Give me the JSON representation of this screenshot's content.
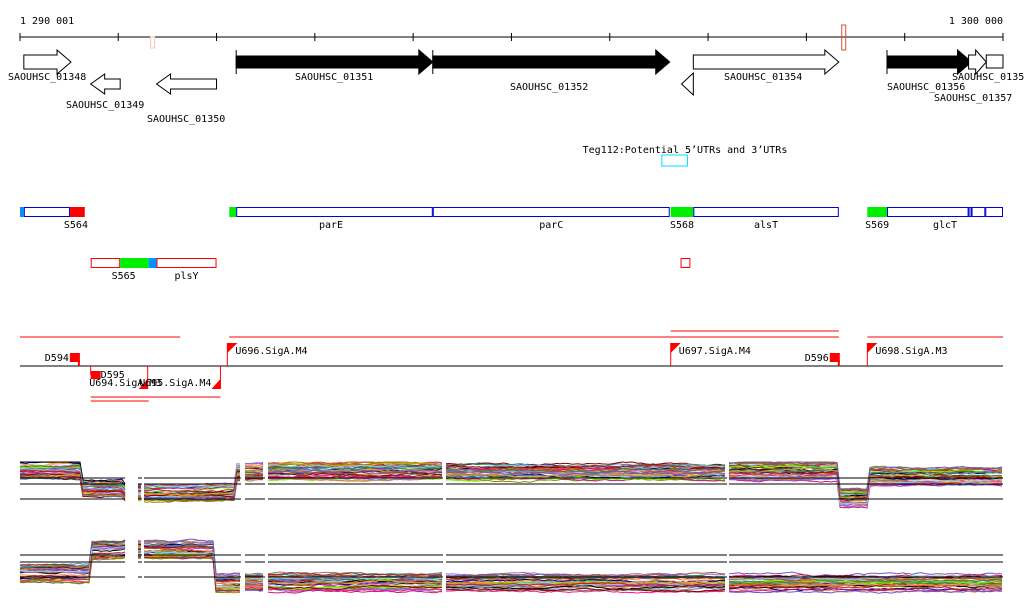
{
  "ruler": {
    "start_label": "1 290 001",
    "end_label": "1 300 000",
    "start": 1290001,
    "end": 1300000,
    "tick_interval": 1000
  },
  "markers": [
    {
      "pos": 1291350,
      "color": "#f4c8b0"
    },
    {
      "pos": 1298380,
      "color": "#e05030"
    }
  ],
  "genes": [
    {
      "label": "SAOUHSC_01348",
      "start": 1290040,
      "end": 1290520,
      "strand": "+",
      "filled": false,
      "row": 0
    },
    {
      "label": "SAOUHSC_01349",
      "start": 1290720,
      "end": 1291020,
      "strand": "-",
      "filled": false,
      "row": 1
    },
    {
      "label": "SAOUHSC_01350",
      "start": 1291390,
      "end": 1292000,
      "strand": "-",
      "filled": false,
      "row": 1
    },
    {
      "label": "SAOUHSC_01351",
      "start": 1292200,
      "end": 1294200,
      "strand": "+",
      "filled": true,
      "row": 0
    },
    {
      "label": "SAOUHSC_01352",
      "start": 1294200,
      "end": 1296610,
      "strand": "+",
      "filled": true,
      "row": 0
    },
    {
      "label": "",
      "start": 1296730,
      "end": 1296850,
      "strand": "-",
      "filled": false,
      "row": 1
    },
    {
      "label": "SAOUHSC_01354",
      "start": 1296850,
      "end": 1298330,
      "strand": "+",
      "filled": false,
      "row": 0
    },
    {
      "label": "SAOUHSC_01356",
      "start": 1298820,
      "end": 1299680,
      "strand": "+",
      "filled": true,
      "row": 0
    },
    {
      "label": "SAOUHSC_0135",
      "start": 1299650,
      "end": 1299830,
      "strand": "+",
      "filled": false,
      "row": 0
    },
    {
      "label": "SAOUHSC_01357",
      "start": 1299830,
      "end": 1300000,
      "strand": "box",
      "filled": false,
      "row": 0
    }
  ],
  "teg": {
    "label": "Teg112:Potential 5’UTRs and 3’UTRs",
    "start": 1296530,
    "end": 1296790,
    "color": "#00e0ff"
  },
  "transcripts": [
    {
      "label": "S564",
      "row": 0,
      "parts": [
        {
          "start": 1290001,
          "end": 1290040,
          "fill": "#0090ff"
        },
        {
          "start": 1290040,
          "end": 1290510,
          "outline": "#0000dd"
        },
        {
          "start": 1290510,
          "end": 1290660,
          "fill": "#ff0000"
        }
      ]
    },
    {
      "label": "parE",
      "row": 0,
      "parts": [
        {
          "start": 1292130,
          "end": 1292200,
          "fill": "#00ee00"
        },
        {
          "start": 1292200,
          "end": 1294200,
          "outline": "#0000dd"
        }
      ]
    },
    {
      "label": "parC",
      "row": 0,
      "parts": [
        {
          "start": 1294200,
          "end": 1296610,
          "outline": "#0000dd"
        }
      ]
    },
    {
      "label": "S568",
      "row": 0,
      "parts": [
        {
          "start": 1296620,
          "end": 1296850,
          "fill": "#00ee00"
        }
      ]
    },
    {
      "label": "alsT",
      "row": 0,
      "parts": [
        {
          "start": 1296850,
          "end": 1298330,
          "outline": "#0000dd"
        }
      ]
    },
    {
      "label": "S569",
      "row": 0,
      "parts": [
        {
          "start": 1298620,
          "end": 1298820,
          "fill": "#00ee00"
        }
      ]
    },
    {
      "label": "glcT",
      "row": 0,
      "parts": [
        {
          "start": 1298820,
          "end": 1299650,
          "outline": "#0000dd"
        },
        {
          "start": 1299650,
          "end": 1299680,
          "outline": "#0000dd"
        },
        {
          "start": 1299680,
          "end": 1299820,
          "outline": "#0000dd"
        },
        {
          "start": 1299820,
          "end": 1300000,
          "outline": "#0000dd"
        }
      ]
    },
    {
      "label": "S565",
      "row": 1,
      "parts": [
        {
          "start": 1290720,
          "end": 1291020,
          "outline": "#ff0000"
        },
        {
          "start": 1291020,
          "end": 1291310,
          "fill": "#00ee00"
        },
        {
          "start": 1291310,
          "end": 1291390,
          "fill": "#0090ff"
        }
      ]
    },
    {
      "label": "plsY",
      "row": 1,
      "parts": [
        {
          "start": 1291390,
          "end": 1292000,
          "outline": "#ff0000"
        }
      ]
    },
    {
      "label": "",
      "row": 1,
      "parts": [
        {
          "start": 1296720,
          "end": 1296820,
          "outline": "#ff0000"
        }
      ]
    }
  ],
  "promoters": {
    "color": "#ff0000",
    "coverage_lines": [
      {
        "start": 1290001,
        "end": 1291630
      },
      {
        "start": 1292130,
        "end": 1298330
      },
      {
        "start": 1298620,
        "end": 1300000
      }
    ],
    "upper_lines": [
      {
        "start": 1296620,
        "end": 1298330
      }
    ],
    "lower_lines": [
      {
        "start": 1290720,
        "end": 1292040
      },
      {
        "start": 1290720,
        "end": 1291310
      }
    ],
    "sites": [
      {
        "label": "D594",
        "pos": 1290600,
        "type": "terminator",
        "side": "above"
      },
      {
        "label": "D595",
        "pos": 1290720,
        "type": "terminator",
        "side": "below"
      },
      {
        "label": "U694.SigA.M3",
        "pos": 1291300,
        "type": "reverse",
        "side": "below"
      },
      {
        "label": "U695.SigA.M4",
        "pos": 1292040,
        "type": "reverse",
        "side": "below"
      },
      {
        "label": "U696.SigA.M4",
        "pos": 1292110,
        "type": "forward",
        "side": "above"
      },
      {
        "label": "U697.SigA.M4",
        "pos": 1296620,
        "type": "forward",
        "side": "above"
      },
      {
        "label": "D596",
        "pos": 1298330,
        "type": "terminator",
        "side": "above"
      },
      {
        "label": "U698.SigA.M3",
        "pos": 1298620,
        "type": "forward",
        "side": "above"
      }
    ]
  },
  "expression": {
    "trace_colors": [
      "#d2691e",
      "#8b8b00",
      "#7cfc00",
      "#c71585",
      "#4682b4",
      "#ff7f50",
      "#9370db",
      "#800000",
      "#2e8b57",
      "#daa520",
      "#a0522d",
      "#6a5acd",
      "#87cefa",
      "#b22222",
      "#556b2f",
      "#ff1493",
      "#000080",
      "#cd853f",
      "#808080",
      "#000000"
    ]
  }
}
